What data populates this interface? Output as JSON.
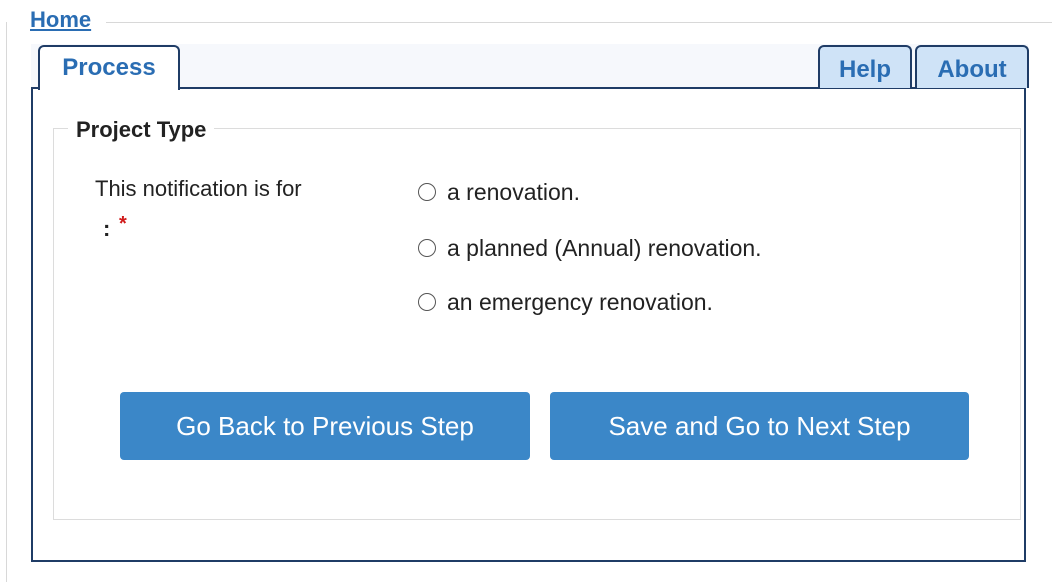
{
  "header": {
    "home_link": "Home"
  },
  "tabs": {
    "process": "Process",
    "help": "Help",
    "about": "About"
  },
  "form": {
    "legend": "Project Type",
    "field_label": "This notification is for",
    "field_label_colon": ":",
    "required_marker": "*",
    "options": [
      {
        "label": "a renovation.",
        "selected": false
      },
      {
        "label": "a planned (Annual) renovation.",
        "selected": false
      },
      {
        "label": "an emergency renovation.",
        "selected": false
      }
    ]
  },
  "buttons": {
    "back": "Go Back to Previous Step",
    "next": "Save and Go to Next Step"
  },
  "colors": {
    "link": "#2a6db3",
    "tab_border": "#1f3c66",
    "inactive_tab_bg": "#cfe3f7",
    "button_bg": "#3b87c8",
    "required": "#d01a1a"
  }
}
